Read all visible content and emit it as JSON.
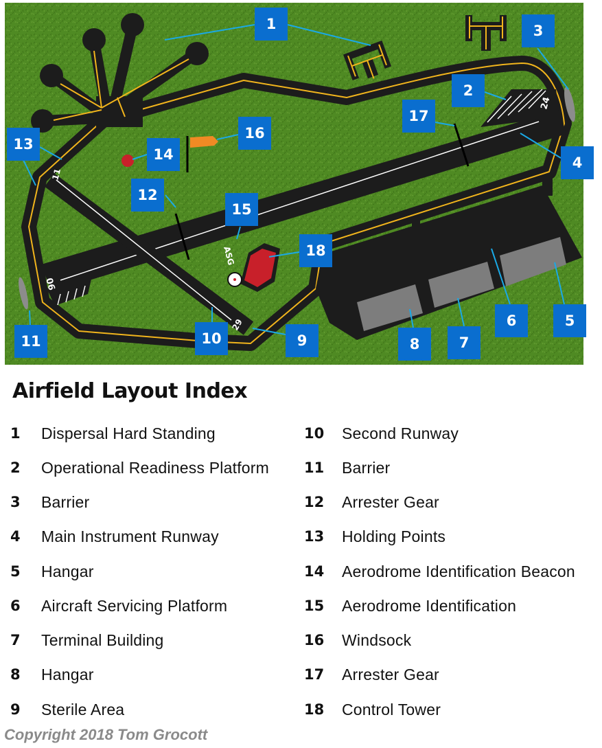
{
  "map": {
    "colors": {
      "grass": "#4f8a23",
      "tarmac": "#1c1c1c",
      "taxi_line": "#f2b51c",
      "label_bg": "#0a6ecf",
      "arrow": "#1aa9e6",
      "tower": "#c8202a",
      "windsock": "#f08a24",
      "beacon": "#c8202a",
      "building": "#7d7d7d",
      "barrier": "#8c8c8c"
    },
    "runway_designators": [
      "24",
      "06",
      "11",
      "29"
    ],
    "identification_text": "ASG",
    "labels": [
      "1",
      "2",
      "3",
      "4",
      "5",
      "6",
      "7",
      "8",
      "9",
      "10",
      "11",
      "12",
      "13",
      "14",
      "15",
      "16",
      "17",
      "18"
    ]
  },
  "index": {
    "title": "Airfield Layout Index",
    "left": [
      {
        "num": "1",
        "name": "Dispersal Hard Standing"
      },
      {
        "num": "2",
        "name": "Operational Readiness Platform"
      },
      {
        "num": "3",
        "name": "Barrier"
      },
      {
        "num": "4",
        "name": "Main Instrument Runway"
      },
      {
        "num": "5",
        "name": "Hangar"
      },
      {
        "num": "6",
        "name": "Aircraft Servicing Platform"
      },
      {
        "num": "7",
        "name": "Terminal Building"
      },
      {
        "num": "8",
        "name": "Hangar"
      },
      {
        "num": "9",
        "name": "Sterile Area"
      }
    ],
    "right": [
      {
        "num": "10",
        "name": "Second Runway"
      },
      {
        "num": "11",
        "name": "Barrier"
      },
      {
        "num": "12",
        "name": "Arrester Gear"
      },
      {
        "num": "13",
        "name": "Holding Points"
      },
      {
        "num": "14",
        "name": "Aerodrome Identification Beacon"
      },
      {
        "num": "15",
        "name": "Aerodrome Identification"
      },
      {
        "num": "16",
        "name": "Windsock"
      },
      {
        "num": "17",
        "name": "Arrester Gear"
      },
      {
        "num": "18",
        "name": "Control Tower"
      }
    ]
  },
  "copyright": "Copyright 2018 Tom Grocott"
}
